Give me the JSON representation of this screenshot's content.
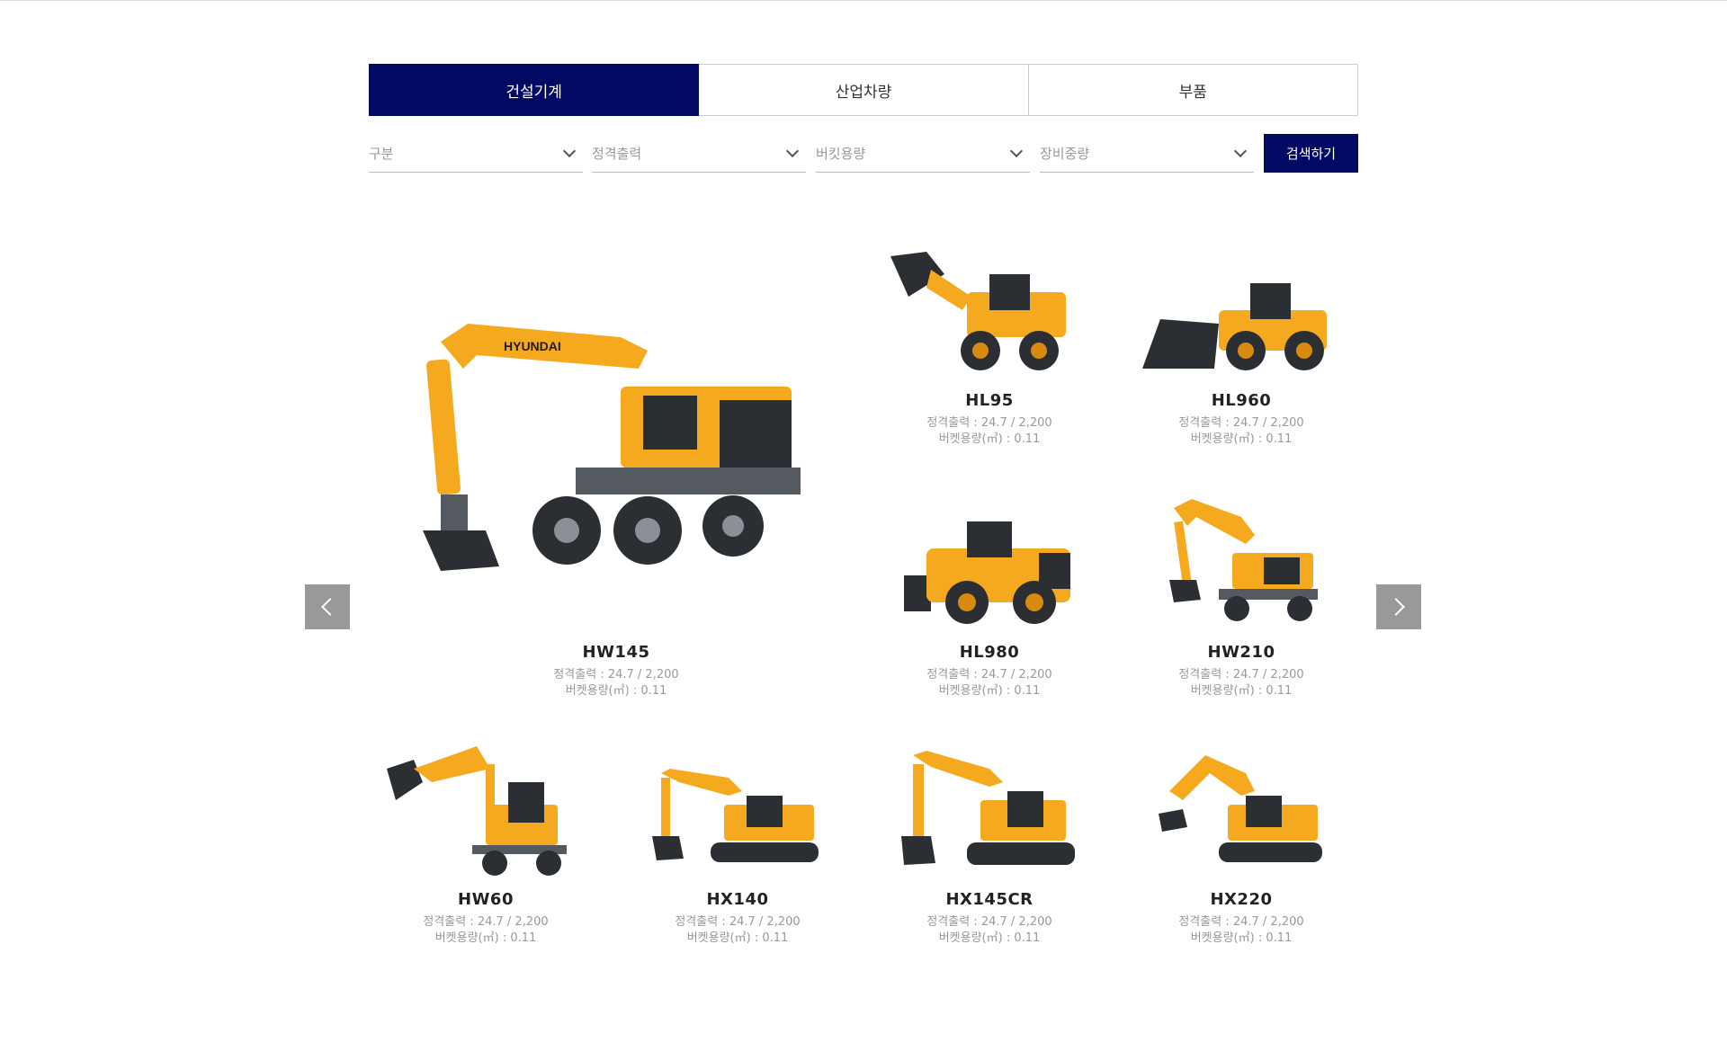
{
  "tabs": [
    "건설기계",
    "산업차량",
    "부품"
  ],
  "filters": {
    "items": [
      "구분",
      "정격출력",
      "버킷용량",
      "장비중량"
    ],
    "search_label": "검색하기"
  },
  "spec_lines": {
    "output": "정격출력 : 24.7 / 2,200",
    "bucket": "버켓용량(㎥) : 0.11"
  },
  "products": [
    {
      "name": "HW145",
      "icon": "wheeled-excavator"
    },
    {
      "name": "HL95",
      "icon": "wheel-loader"
    },
    {
      "name": "HL960",
      "icon": "wheel-loader"
    },
    {
      "name": "HL980",
      "icon": "wheel-loader"
    },
    {
      "name": "HW210",
      "icon": "wheeled-excavator"
    },
    {
      "name": "HW60",
      "icon": "wheeled-excavator"
    },
    {
      "name": "HX140",
      "icon": "crawler-excavator"
    },
    {
      "name": "HX145CR",
      "icon": "crawler-excavator"
    },
    {
      "name": "HX220",
      "icon": "crawler-excavator"
    }
  ],
  "machine_label": "HYUNDAI",
  "colors": {
    "primary": "#000a64",
    "machine_yellow": "#f5a91e",
    "arrow_bg": "#999999"
  },
  "icons": {
    "prev": "chevron-left-icon",
    "next": "chevron-right-icon",
    "dropdown": "chevron-down-icon"
  }
}
